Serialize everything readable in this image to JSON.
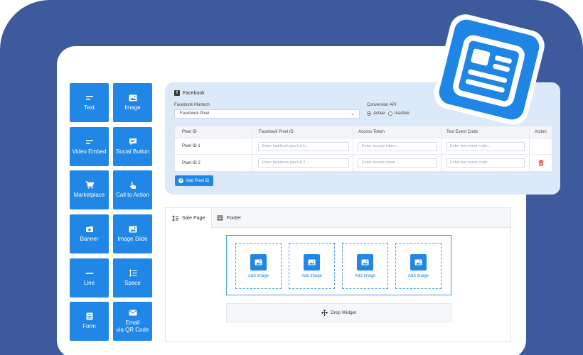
{
  "palette": {
    "primary": "#2087e6",
    "background": "#3d5a9c",
    "panel": "#dbe9f8",
    "danger": "#e53935"
  },
  "sidebar": {
    "widgets": [
      {
        "label": "Text",
        "icon": "text-icon"
      },
      {
        "label": "Image",
        "icon": "image-icon"
      },
      {
        "label": "Video Embed",
        "icon": "video-icon"
      },
      {
        "label": "Social Button",
        "icon": "chat-icon"
      },
      {
        "label": "Marketplace",
        "icon": "cart-icon"
      },
      {
        "label": "Call to Action",
        "icon": "pointer-icon"
      },
      {
        "label": "Banner",
        "icon": "banner-icon"
      },
      {
        "label": "Image Slide",
        "icon": "image-icon"
      },
      {
        "label": "Line",
        "icon": "line-icon"
      },
      {
        "label": "Space",
        "icon": "space-icon"
      },
      {
        "label": "Form",
        "icon": "form-icon"
      },
      {
        "label": "Email\nvia QR Code",
        "icon": "email-icon"
      }
    ]
  },
  "facebook": {
    "title": "Facebook",
    "martech_label": "Facebook Martech",
    "martech_value": "Facebook Pixel",
    "conversion_label": "Conversion API",
    "conversion_options": [
      "Active",
      "Inactive"
    ],
    "conversion_selected": "Active",
    "table": {
      "headers": [
        "Pixel ID",
        "Facebook Pixel ID",
        "Access Token",
        "Test Event Code",
        "Action"
      ],
      "rows": [
        {
          "pixel_id": "Pixel ID 1",
          "pixel_placeholder": "Enter facebook pixel id 1...",
          "token_placeholder": "Enter access token...",
          "test_placeholder": "Enter test event code..."
        },
        {
          "pixel_id": "Pixel ID 2",
          "pixel_placeholder": "Enter facebook pixel id 2...",
          "token_placeholder": "Enter access token...",
          "test_placeholder": "Enter test event code..."
        }
      ]
    },
    "add_button": "Add Pixel ID"
  },
  "builder": {
    "tabs": [
      {
        "label": "Sale Page",
        "icon": "sort-icon"
      },
      {
        "label": "Footer",
        "icon": "layout-icon"
      }
    ],
    "slots": [
      "Add Image",
      "Add Image",
      "Add Image",
      "Add Image"
    ],
    "drop_widget": "Drop Widget"
  }
}
